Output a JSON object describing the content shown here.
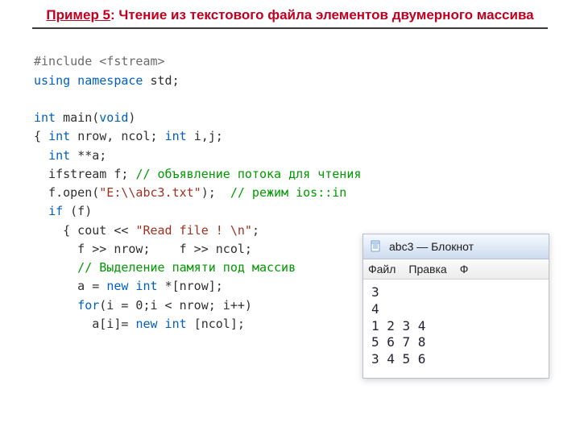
{
  "title_example": "Пример 5",
  "title_rest": ": Чтение из текстового файла элементов двумерного массива",
  "code": {
    "l01": {
      "a": "#include ",
      "b": "<fstream>"
    },
    "l02": {
      "a": "using namespace ",
      "b": "std",
      ";": ";"
    },
    "l04": {
      "a": "int ",
      "b": "main",
      "c": "(",
      "d": "void",
      "e": ")"
    },
    "l05": {
      "a": "{ ",
      "b": "int ",
      "c": "nrow, ncol; ",
      "d": "int ",
      "e": "i,j;"
    },
    "l06": {
      "a": "  ",
      "b": "int ",
      "c": "**a;"
    },
    "l07": {
      "a": "  ifstream f; ",
      "cm": "// объявление потока для чтения"
    },
    "l08": {
      "a": "  f.open(",
      "s": "\"E:\\\\abc3.txt\"",
      "b": ");  ",
      "cm": "// режим ios::in"
    },
    "l09": {
      "a": "  ",
      "b": "if ",
      "c": "(f)"
    },
    "l10": {
      "a": "    { cout << ",
      "s": "\"Read file ! \\n\"",
      "b": ";"
    },
    "l11": {
      "a": "      f >> nrow;    f >> ncol;"
    },
    "l12": {
      "cm": "      // Выделение памяти под массив"
    },
    "l13": {
      "a": "      a = ",
      "b": "new int ",
      "c": "*[nrow];"
    },
    "l14": {
      "a": "      ",
      "b": "for",
      "c": "(i = 0;i < nrow; i++)"
    },
    "l15": {
      "a": "        a[i]= ",
      "b": "new int ",
      "c": "[ncol];"
    }
  },
  "notepad": {
    "title": "abc3 — Блокнот",
    "menu": [
      "Файл",
      "Правка",
      "Ф"
    ],
    "content": "3\n4\n1 2 3 4\n5 6 7 8\n3 4 5 6"
  }
}
